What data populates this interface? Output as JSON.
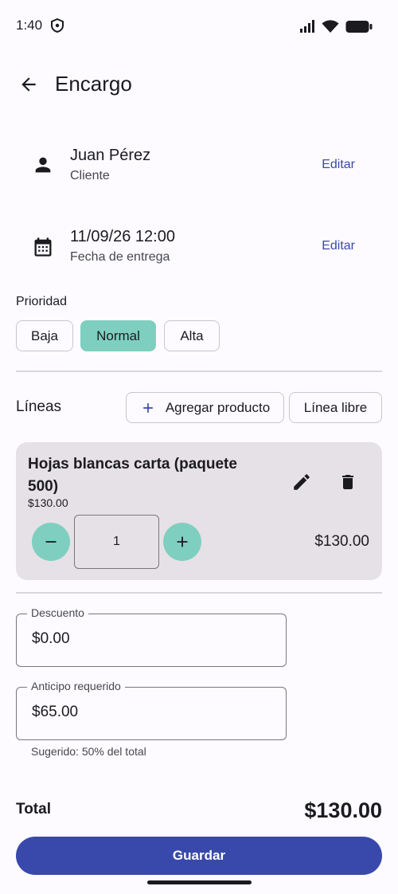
{
  "status_bar": {
    "time": "1:40"
  },
  "app_bar": {
    "title": "Encargo"
  },
  "customer": {
    "name": "Juan Pérez",
    "subtitle": "Cliente",
    "edit_label": "Editar"
  },
  "delivery": {
    "datetime": "11/09/26 12:00",
    "subtitle": "Fecha de entrega",
    "edit_label": "Editar"
  },
  "priority": {
    "label": "Prioridad",
    "options": [
      "Baja",
      "Normal",
      "Alta"
    ],
    "selected": "Normal"
  },
  "lines": {
    "label": "Líneas",
    "add_product_label": "Agregar producto",
    "free_line_label": "Línea libre",
    "items": [
      {
        "name": "Hojas blancas carta (paquete 500)",
        "unit_price": "$130.00",
        "quantity": "1",
        "total": "$130.00"
      }
    ]
  },
  "discount": {
    "label": "Descuento",
    "value": "$0.00"
  },
  "deposit": {
    "label": "Anticipo requerido",
    "value": "$65.00",
    "helper": "Sugerido: 50% del total"
  },
  "summary": {
    "total_label": "Total",
    "total_value": "$130.00"
  },
  "actions": {
    "save_label": "Guardar"
  },
  "colors": {
    "primary": "#3949ab",
    "accent": "#7fcfc0",
    "card": "#e6e1e6"
  }
}
